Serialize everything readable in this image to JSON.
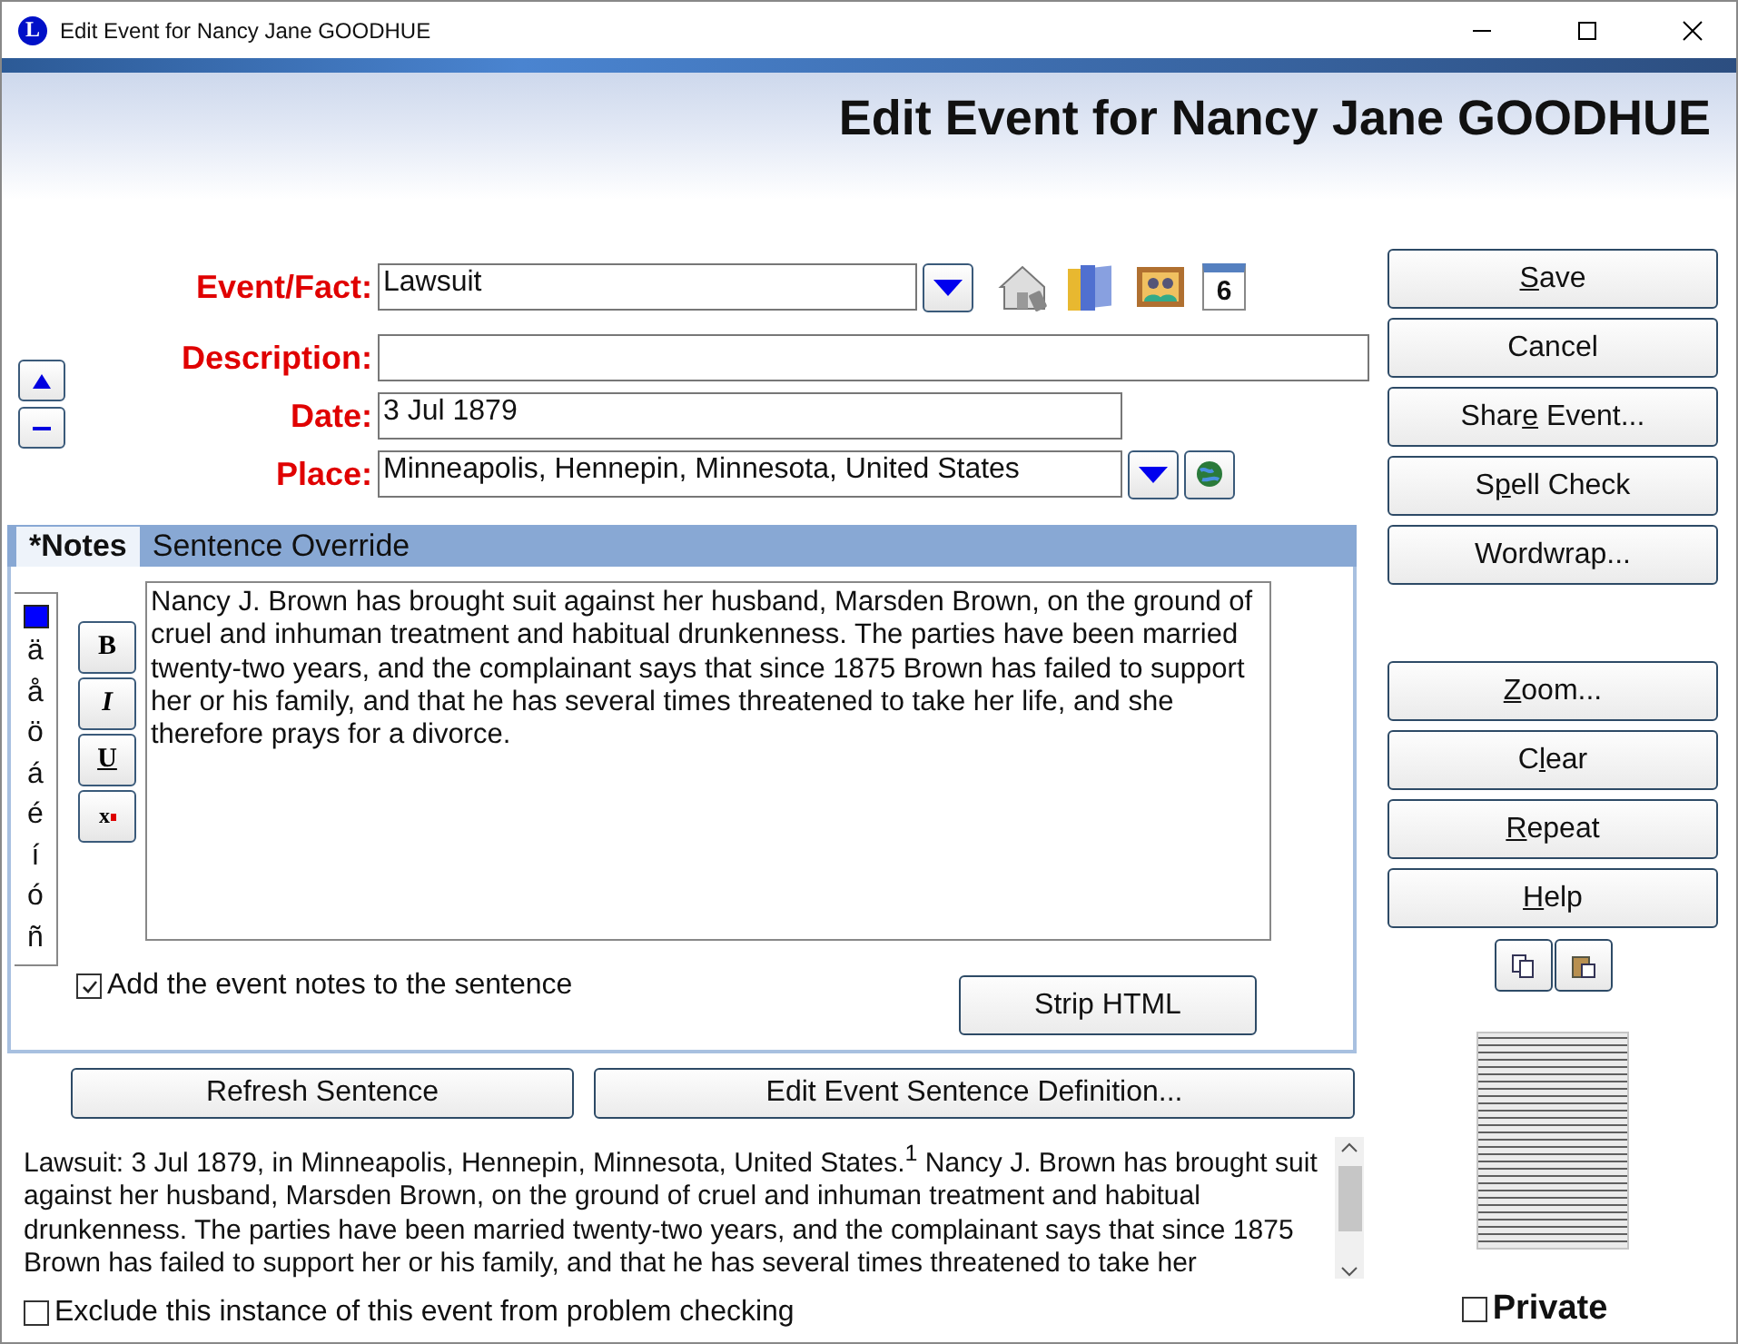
{
  "window": {
    "app_icon_letter": "L",
    "title": "Edit Event for Nancy Jane GOODHUE"
  },
  "header": {
    "title": "Edit Event for Nancy Jane GOODHUE"
  },
  "fields": [
    {
      "kind": "dropdown",
      "label": "Event/Fact:",
      "value": "Lawsuit"
    },
    {
      "kind": "text",
      "label": "Description:"
    },
    {
      "kind": "date",
      "label": "Date:",
      "value": "3 Jul 1879"
    },
    {
      "kind": "place",
      "label": "Place:",
      "value": "Minneapolis, Hennepin, Minnesota, United States"
    }
  ],
  "calendar_day": "6",
  "tabs": [
    {
      "label": "*Notes",
      "selected": true
    },
    {
      "label": "Sentence Override",
      "selected": false
    }
  ],
  "special_characters": [
    "ä",
    "å",
    "ö",
    "á",
    "é",
    "í",
    "ó",
    "ñ"
  ],
  "format_buttons": [
    {
      "kind": "bold",
      "label": "B"
    },
    {
      "kind": "italic",
      "label": "I"
    },
    {
      "kind": "underline",
      "label": "U"
    },
    {
      "kind": "superscript",
      "label": "x"
    }
  ],
  "notes": "Nancy J. Brown has brought suit against her husband, Marsden Brown, on the ground of cruel and inhuman treatment and habitual drunkenness. The parties have been married twenty-two years, and the complainant says that since 1875 Brown has failed to support her or his family, and that he has several times threatened to take her life, and she therefore prays for a divorce.",
  "add_notes_checkbox": {
    "label": "Add the event notes to the sentence",
    "checked": true
  },
  "strip_html_button": "Strip HTML",
  "sentence_buttons": [
    "Refresh Sentence",
    "Edit Event Sentence Definition..."
  ],
  "sentence": "Lawsuit: 3 Jul 1879, in Minneapolis, Hennepin, Minnesota, United States.$^{1}$ Nancy J. Brown has brought suit against her husband, Marsden Brown, on the ground of cruel and inhuman treatment and habitual drunkenness. The parties have been married twenty-two years, and the complainant says that since 1875 Brown has failed to support her or his family, and that he has several times threatened to take her",
  "exclude_checkbox": {
    "label": "Exclude this instance of this event from problem checking",
    "checked": false
  },
  "action_buttons_top": [
    {
      "key": "S",
      "post": "ave"
    },
    {
      "pre": "Cancel"
    },
    {
      "pre": "Shar",
      "key": "e",
      "post": " Event..."
    },
    {
      "pre": "S",
      "key": "p",
      "post": "ell Check"
    },
    {
      "pre": "Wordwrap..."
    }
  ],
  "action_buttons_bottom": [
    {
      "key": "Z",
      "post": "oom..."
    },
    {
      "pre": "C",
      "key": "l",
      "post": "ear"
    },
    {
      "key": "R",
      "post": "epeat"
    },
    {
      "key": "H",
      "post": "elp"
    }
  ],
  "private_checkbox": {
    "label": "Private",
    "checked": false
  }
}
